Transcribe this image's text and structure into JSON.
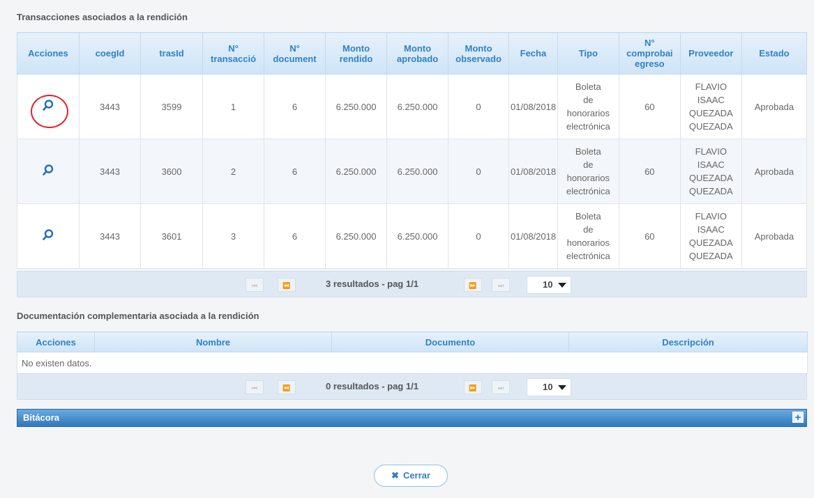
{
  "transactions_section": {
    "title": "Transacciones asociados a la rendición",
    "headers": [
      "Acciones",
      "coegId",
      "trasId",
      "N°\ntransacció",
      "N°\ndocument",
      "Monto\nrendido",
      "Monto\naprobado",
      "Monto\nobservado",
      "Fecha",
      "Tipo",
      "N°\ncomprobai\negreso",
      "Proveedor",
      "Estado"
    ],
    "rows": [
      {
        "coegId": "3443",
        "trasId": "3599",
        "transaccion": "1",
        "documento": "6",
        "monto_rendido": "6.250.000",
        "monto_aprobado": "6.250.000",
        "monto_observado": "0",
        "fecha": "01/08/2018",
        "tipo": "Boleta\nde\nhonorarios\nelectrónica",
        "comprobante": "60",
        "proveedor": "FLAVIO\nISAAC\nQUEZADA\nQUEZADA",
        "estado": "Aprobada"
      },
      {
        "coegId": "3443",
        "trasId": "3600",
        "transaccion": "2",
        "documento": "6",
        "monto_rendido": "6.250.000",
        "monto_aprobado": "6.250.000",
        "monto_observado": "0",
        "fecha": "01/08/2018",
        "tipo": "Boleta\nde\nhonorarios\nelectrónica",
        "comprobante": "60",
        "proveedor": "FLAVIO\nISAAC\nQUEZADA\nQUEZADA",
        "estado": "Aprobada"
      },
      {
        "coegId": "3443",
        "trasId": "3601",
        "transaccion": "3",
        "documento": "6",
        "monto_rendido": "6.250.000",
        "monto_aprobado": "6.250.000",
        "monto_observado": "0",
        "fecha": "01/08/2018",
        "tipo": "Boleta\nde\nhonorarios\nelectrónica",
        "comprobante": "60",
        "proveedor": "FLAVIO\nISAAC\nQUEZADA\nQUEZADA",
        "estado": "Aprobada"
      }
    ],
    "pager": {
      "info": "3 resultados - pag 1/1",
      "page_size": "10"
    }
  },
  "docs_section": {
    "title": "Documentación complementaria asociada a la rendición",
    "headers": [
      "Acciones",
      "Nombre",
      "Documento",
      "Descripción"
    ],
    "empty_text": "No existen datos.",
    "pager": {
      "info": "0 resultados - pag 1/1",
      "page_size": "10"
    }
  },
  "bitacora": {
    "label": "Bitácora",
    "toggle": "+"
  },
  "close_button": {
    "label": "Cerrar",
    "icon": "✖"
  },
  "pager_icons": {
    "first": "⏮",
    "prev": "⏪",
    "next": "⏩",
    "last": "⏭"
  },
  "colors": {
    "header_text": "#2f82c4",
    "accent": "#2f78bd",
    "highlight": "#e3202a"
  }
}
